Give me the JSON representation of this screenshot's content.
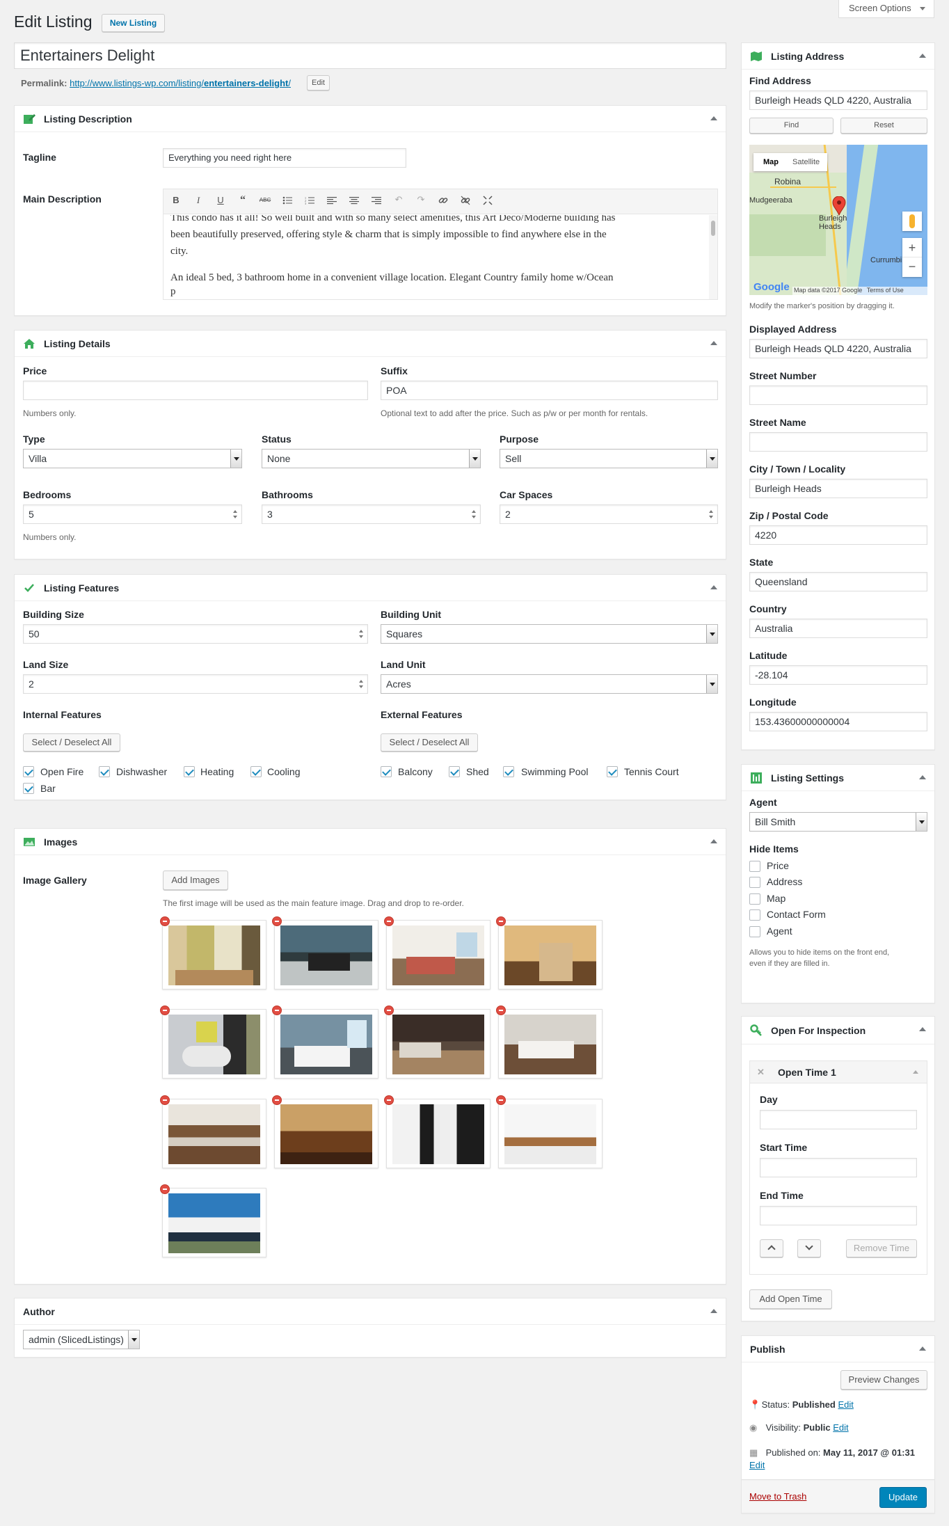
{
  "header": {
    "title": "Edit Listing",
    "new_button": "New Listing",
    "screen_options": "Screen Options"
  },
  "post": {
    "title": "Entertainers Delight",
    "permalink_label": "Permalink:",
    "permalink_base": "http://www.listings-wp.com/listing/",
    "permalink_slug": "entertainers-delight",
    "permalink_tail": "/",
    "edit_button": "Edit"
  },
  "description": {
    "title": "Listing Description",
    "tagline_label": "Tagline",
    "tagline_value": "Everything you need right here",
    "main_label": "Main Description",
    "editor_lines": [
      "This condo has it all! So well built and with so many select amenities, this Art Deco/Moderne building has",
      "been beautifully preserved, offering style & charm that is simply impossible to find anywhere else in the",
      "city.",
      "An ideal 5 bed, 3 bathroom home in a convenient village location. Elegant Country family home w/Ocean",
      "p"
    ],
    "toolbar": [
      "B",
      "I",
      "U",
      "❝",
      "ABC",
      "≡",
      "≡",
      "≡",
      "≡",
      "≡",
      "↶",
      "↷",
      "🔗",
      "⛓",
      "⤢"
    ]
  },
  "details": {
    "title": "Listing Details",
    "price_label": "Price",
    "price_value": "",
    "price_note": "Numbers only.",
    "suffix_label": "Suffix",
    "suffix_value": "POA",
    "suffix_note": "Optional text to add after the price. Such as p/w or per month for rentals.",
    "type_label": "Type",
    "type_value": "Villa",
    "status_label": "Status",
    "status_value": "None",
    "purpose_label": "Purpose",
    "purpose_value": "Sell",
    "bedrooms_label": "Bedrooms",
    "bedrooms_value": "5",
    "bathrooms_label": "Bathrooms",
    "bathrooms_value": "3",
    "car_label": "Car Spaces",
    "car_value": "2",
    "numbers_note": "Numbers only."
  },
  "features": {
    "title": "Listing Features",
    "building_size_label": "Building Size",
    "building_size_value": "50",
    "building_unit_label": "Building Unit",
    "building_unit_value": "Squares",
    "land_size_label": "Land Size",
    "land_size_value": "2",
    "land_unit_label": "Land Unit",
    "land_unit_value": "Acres",
    "internal_label": "Internal Features",
    "external_label": "External Features",
    "select_all": "Select / Deselect All",
    "internal": [
      "Open Fire",
      "Dishwasher",
      "Heating",
      "Cooling",
      "Bar"
    ],
    "external": [
      "Balcony",
      "Shed",
      "Swimming Pool",
      "Tennis Court"
    ]
  },
  "images": {
    "title": "Images",
    "gallery_label": "Image Gallery",
    "add_button": "Add Images",
    "note": "The first image will be used as the main feature image. Drag and drop to re-order."
  },
  "author": {
    "title": "Author",
    "value": "admin (SlicedListings)"
  },
  "address": {
    "title": "Listing Address",
    "find_label": "Find Address",
    "find_value": "Burleigh Heads QLD 4220, Australia",
    "find_btn": "Find",
    "reset_btn": "Reset",
    "map_tab": "Map",
    "satellite_tab": "Satellite",
    "map_places": [
      "Robina",
      "Mudgeeraba",
      "Burleigh Heads",
      "Currumbin"
    ],
    "map_credit": "Map data ©2017 Google",
    "map_terms": "Terms of Use",
    "map_logo": "Google",
    "map_note": "Modify the marker's position by dragging it.",
    "displayed_label": "Displayed Address",
    "displayed_value": "Burleigh Heads QLD 4220, Australia",
    "street_number_label": "Street Number",
    "street_number_value": "",
    "street_name_label": "Street Name",
    "street_name_value": "",
    "city_label": "City / Town / Locality",
    "city_value": "Burleigh Heads",
    "zip_label": "Zip / Postal Code",
    "zip_value": "4220",
    "state_label": "State",
    "state_value": "Queensland",
    "country_label": "Country",
    "country_value": "Australia",
    "lat_label": "Latitude",
    "lat_value": "-28.104",
    "lng_label": "Longitude",
    "lng_value": "153.43600000000004"
  },
  "settings": {
    "title": "Listing Settings",
    "agent_label": "Agent",
    "agent_value": "Bill Smith",
    "hide_label": "Hide Items",
    "hide_items": [
      "Price",
      "Address",
      "Map",
      "Contact Form",
      "Agent"
    ],
    "hide_note_1": "Allows you to hide items on the front end,",
    "hide_note_2": "even if they are filled in."
  },
  "inspection": {
    "title": "Open For Inspection",
    "slot_title": "Open Time 1",
    "day_label": "Day",
    "start_label": "Start Time",
    "end_label": "End Time",
    "remove_btn": "Remove Time",
    "add_btn": "Add Open Time"
  },
  "publish": {
    "title": "Publish",
    "preview_btn": "Preview Changes",
    "status_label": "Status:",
    "status_value": "Published",
    "visibility_label": "Visibility:",
    "visibility_value": "Public",
    "published_label": "Published on:",
    "published_value": "May 11, 2017 @ 01:31",
    "edit_link": "Edit",
    "trash": "Move to Trash",
    "update": "Update"
  },
  "colors": {
    "accent": "#0073aa",
    "update_bg": "#0085ba",
    "danger": "#a00",
    "check": "#1e8cbe",
    "remove_dot": "#e14d43"
  }
}
